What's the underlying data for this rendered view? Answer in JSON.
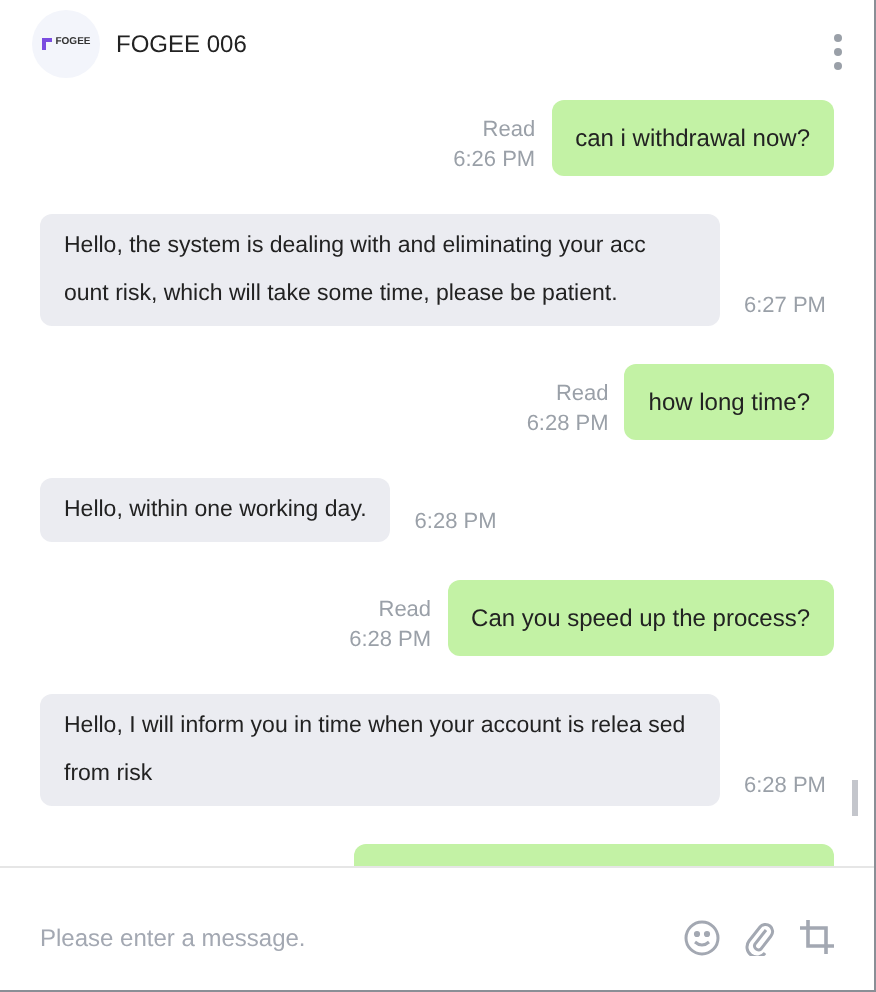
{
  "header": {
    "logo_text": "FOGEE",
    "title": "FOGEE 006"
  },
  "messages": [
    {
      "kind": "sent",
      "text": "can i withdrawal now?",
      "status": "Read",
      "time": "6:26 PM"
    },
    {
      "kind": "received",
      "text": "Hello, the system is dealing with and eliminating your acc ount risk, which will take some time, please be patient.",
      "time": "6:27 PM"
    },
    {
      "kind": "sent",
      "text": "how long time?",
      "status": "Read",
      "time": "6:28 PM"
    },
    {
      "kind": "received",
      "text": "Hello, within one working day.",
      "time": "6:28 PM"
    },
    {
      "kind": "sent",
      "text": "Can you speed up the process?",
      "status": "Read",
      "time": "6:28 PM"
    },
    {
      "kind": "received",
      "text": "Hello, I will inform you in time when your account is relea sed from risk",
      "time": "6:28 PM"
    },
    {
      "kind": "partial"
    }
  ],
  "composer": {
    "placeholder": "Please enter a message."
  }
}
